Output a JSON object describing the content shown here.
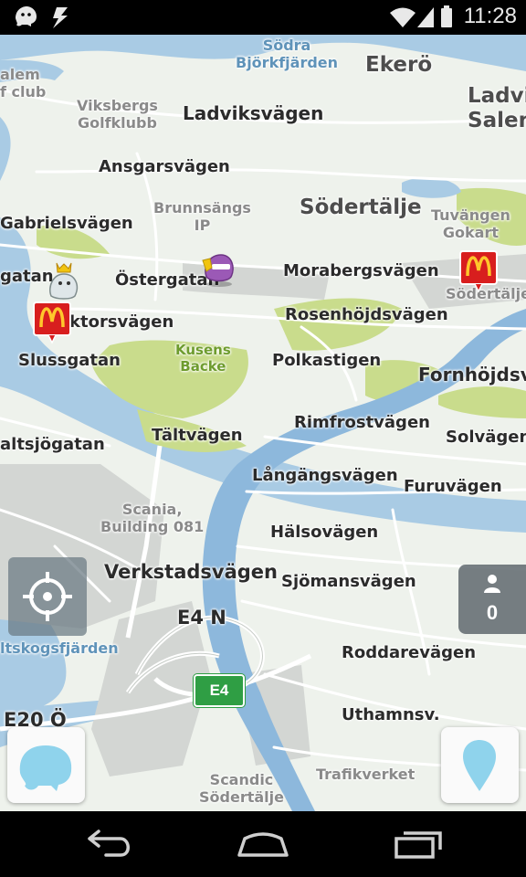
{
  "status_bar": {
    "time": "11:28"
  },
  "map": {
    "place_labels": [
      {
        "id": "ekero",
        "text": "Ekerö",
        "kind": "big"
      },
      {
        "id": "ladvik-salen",
        "text": "Ladvik\nSalen",
        "kind": "big"
      },
      {
        "id": "sodertalje",
        "text": "Södertälje",
        "kind": "big"
      },
      {
        "id": "fornhojdsv",
        "text": "Fornhöjdsv",
        "kind": "street"
      }
    ],
    "water_labels": [
      {
        "id": "sodra-bjorkfjarden",
        "text": "Södra\nBjörkfjärden"
      },
      {
        "id": "tskogsfjarden",
        "text": "ltskogsfjärden"
      }
    ],
    "poi_labels": [
      {
        "id": "golf-club",
        "text": "alem\nf club"
      },
      {
        "id": "viksbergs-golfklubb",
        "text": "Viksbergs\nGolfklubb"
      },
      {
        "id": "brunnsangs-ip",
        "text": "Brunnsängs\nIP"
      },
      {
        "id": "tuvangen-gokart",
        "text": "Tuvängen\nGokart"
      },
      {
        "id": "scania-building",
        "text": "Scania,\nBuilding 081"
      },
      {
        "id": "scandic-sodertalje",
        "text": "Scandic\nSödertälje"
      },
      {
        "id": "trafikverket",
        "text": "Trafikverket"
      },
      {
        "id": "sodertalje-mcd",
        "text": "Södertälje"
      }
    ],
    "park_labels": [
      {
        "id": "kusens-backe",
        "text": "Kusens\nBacke"
      }
    ],
    "street_labels": [
      {
        "id": "ladviksvagen",
        "text": "Ladviksvägen"
      },
      {
        "id": "ansgarsvagen",
        "text": "Ansgarsvägen"
      },
      {
        "id": "gabrielsvagen",
        "text": "Gabrielsvägen"
      },
      {
        "id": "gatan",
        "text": "gatan"
      },
      {
        "id": "ostergatan",
        "text": "Östergatan"
      },
      {
        "id": "morabergsvagen",
        "text": "Morabergsvägen"
      },
      {
        "id": "ktorsvagen",
        "text": "ktorsvägen"
      },
      {
        "id": "rosenhojdsvagen",
        "text": "Rosenhöjdsvägen"
      },
      {
        "id": "slussgatan",
        "text": "Slussgatan"
      },
      {
        "id": "polkastigen",
        "text": "Polkastigen"
      },
      {
        "id": "rimfrostvagen",
        "text": "Rimfrostvägen"
      },
      {
        "id": "solvagen",
        "text": "Solvägen"
      },
      {
        "id": "altsjogatan",
        "text": "altsjögatan"
      },
      {
        "id": "taltvagen",
        "text": "Tältvägen"
      },
      {
        "id": "langangsvagen",
        "text": "Långängsvägen"
      },
      {
        "id": "furuvagen",
        "text": "Furuvägen"
      },
      {
        "id": "halsovagen",
        "text": "Hälsovägen"
      },
      {
        "id": "verkstadsvagen",
        "text": "Verkstadsvägen"
      },
      {
        "id": "sjomansvagen",
        "text": "Sjömansvägen"
      },
      {
        "id": "roddarevagen",
        "text": "Roddarevägen"
      },
      {
        "id": "uthamnsv",
        "text": "Uthamnsv."
      }
    ],
    "highway_labels": [
      {
        "id": "e4-n",
        "text": "E4 N"
      },
      {
        "id": "e20-o",
        "text": "E20 Ö"
      }
    ],
    "e4_shield": "E4",
    "users_count": "0",
    "colors": {
      "water": "#a9cbe4",
      "river": "#8db8dc",
      "park": "#c9dc8c",
      "urban": "#d3d6d3",
      "land": "#eef2ec"
    }
  }
}
